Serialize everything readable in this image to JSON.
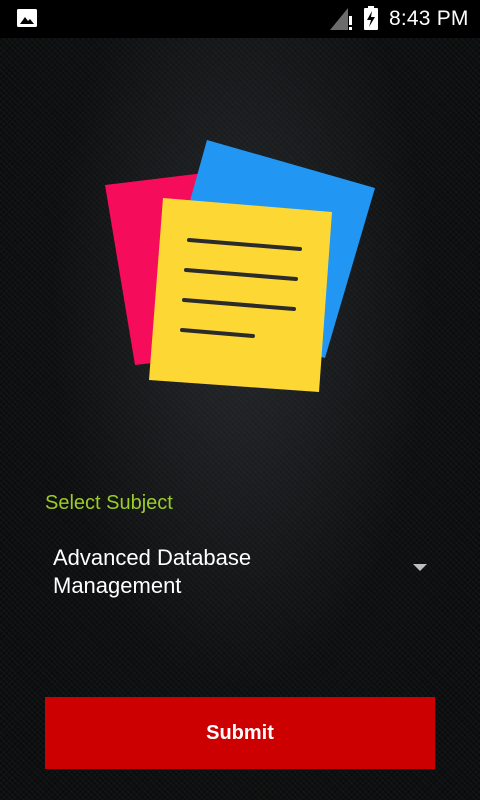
{
  "status_bar": {
    "time": "8:43 PM",
    "icons": [
      "gallery-icon",
      "signal-no-data-icon",
      "battery-charging-icon"
    ]
  },
  "illustration": {
    "icon": "notes-icon",
    "colors": {
      "back_page": "#f50c5a",
      "middle_page": "#2196f3",
      "front_page": "#fdd835",
      "lines": "#2b2b2b"
    }
  },
  "form": {
    "subject_label": "Select Subject",
    "selected_subject": "Advanced Database Management",
    "submit_label": "Submit"
  },
  "colors": {
    "accent_label": "#9ccc27",
    "submit_button": "#cc0000"
  }
}
